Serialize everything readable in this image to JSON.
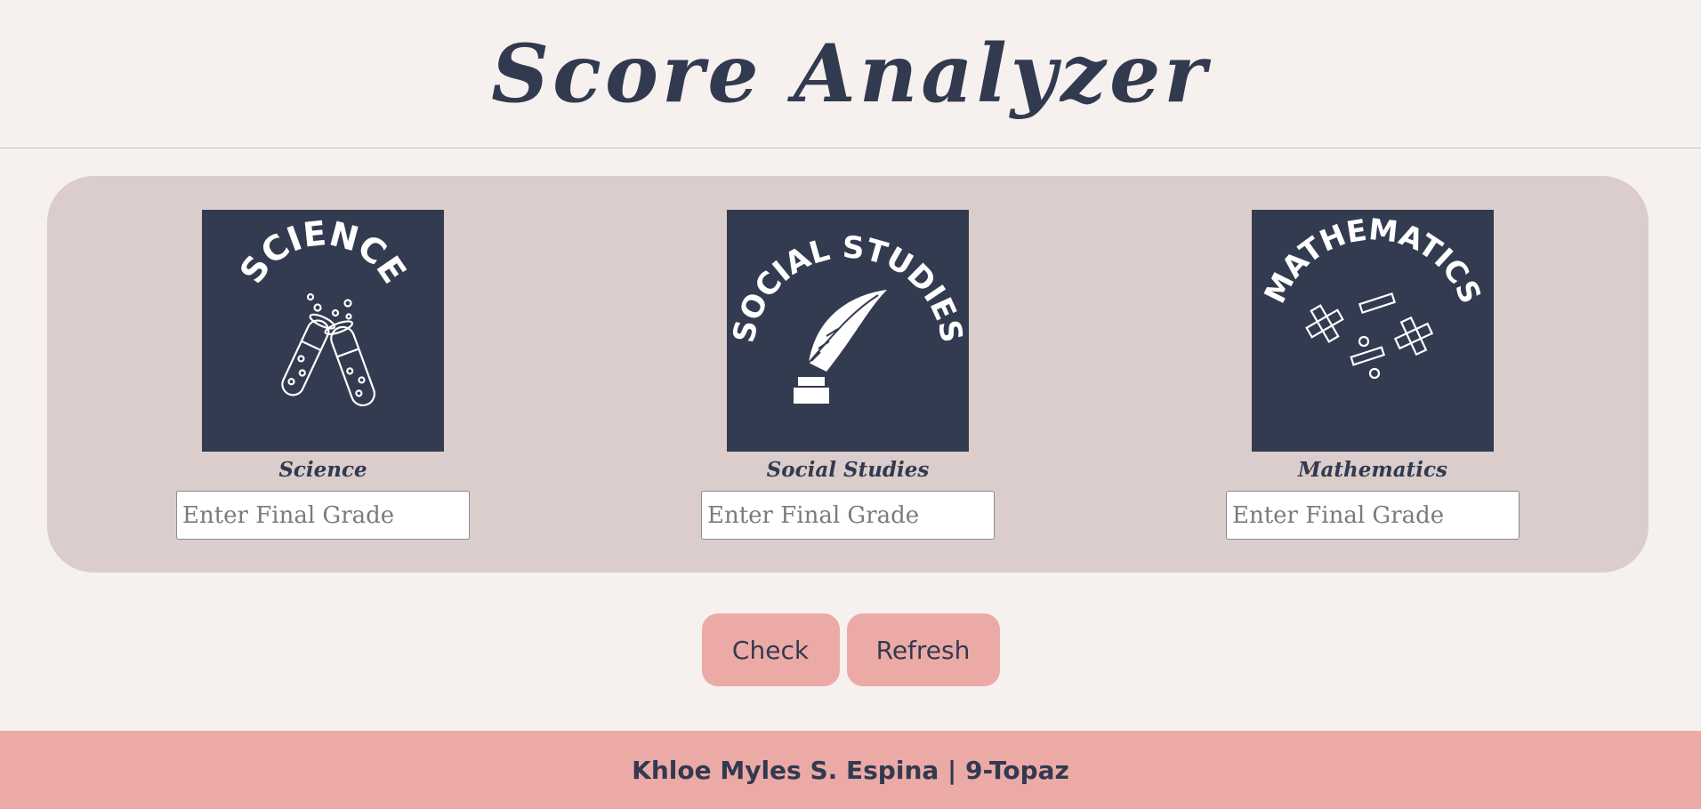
{
  "header": {
    "title": "Score Analyzer"
  },
  "subjects": [
    {
      "label": "Science",
      "badge_text": "SCIENCE",
      "icon": "test-tubes-icon",
      "input_placeholder": "Enter Final Grade",
      "input_value": ""
    },
    {
      "label": "Social Studies",
      "badge_text": "SOCIAL STUDIES",
      "icon": "quill-inkwell-icon",
      "input_placeholder": "Enter Final Grade",
      "input_value": ""
    },
    {
      "label": "Mathematics",
      "badge_text": "MATHEMATICS",
      "icon": "math-operators-icon",
      "input_placeholder": "Enter Final Grade",
      "input_value": ""
    }
  ],
  "actions": {
    "check_label": "Check",
    "refresh_label": "Refresh"
  },
  "footer": {
    "credit": "Khloe Myles S. Espina | 9-Topaz"
  },
  "colors": {
    "background": "#f6f1ef",
    "panel": "#dacdcb",
    "badge": "#333b50",
    "accent": "#ecaaa7",
    "text": "#323a4f"
  }
}
